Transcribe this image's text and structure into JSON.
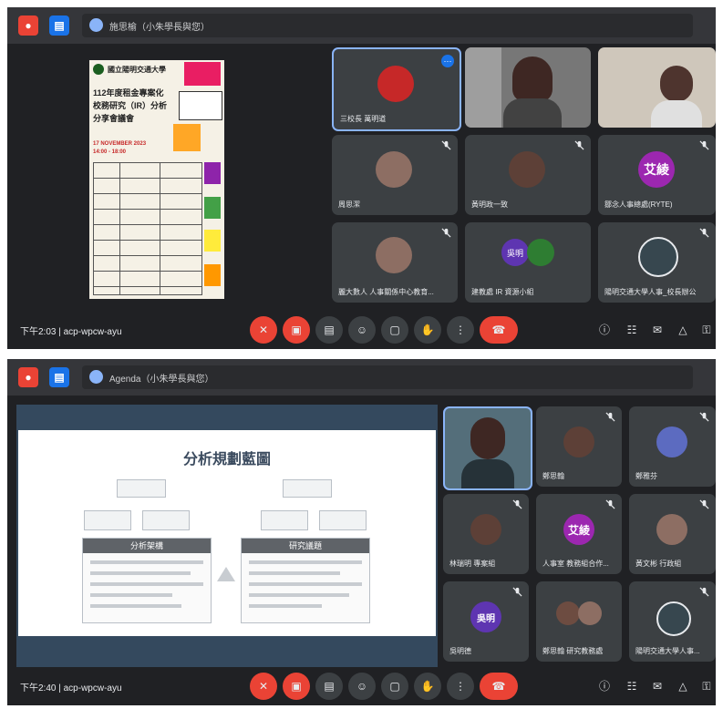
{
  "screenshots": [
    {
      "tab_title": "施思榆（小朱學長與您）",
      "clock": "下午2:03",
      "meeting_code": "acp-wpcw-ayu",
      "poster": {
        "org": "國立陽明交通大學",
        "title_lines": [
          "112年度租金專案化",
          "校務研究（IR）分析",
          "分享會議會"
        ],
        "date": "17 NOVEMBER 2023",
        "time": "14:00 - 18:00"
      },
      "participants": [
        {
          "name": "三校長 萬明道",
          "avatar": "",
          "color": "#c62828"
        },
        {
          "name": "",
          "avatar": "",
          "color": "#5d4037"
        },
        {
          "name": "",
          "avatar": "",
          "color": "#6d4c41"
        },
        {
          "name": "周思潔",
          "avatar": "",
          "color": "#8d6e63"
        },
        {
          "name": "黃明政一致",
          "avatar": "",
          "color": "#5d4037"
        },
        {
          "name": "鄒念人事總處(RYTE)",
          "avatar": "艾綾",
          "color": "#9c27b0"
        },
        {
          "name": "麗大數人 人事關係中心教育...",
          "avatar": "",
          "color": "#8d6e63"
        },
        {
          "name": "建教處 IR 資源小組",
          "avatar": "吳明",
          "color": "#5e35b1"
        },
        {
          "name": "陽明交通大學人事_校長辦公",
          "avatar": "",
          "color": "#37474f"
        }
      ]
    },
    {
      "tab_title": "Agenda（小朱學長與您）",
      "clock": "下午2:40",
      "meeting_code": "acp-wpcw-ayu",
      "slide": {
        "title": "分析規劃藍圖",
        "panel_left": "分析架構",
        "panel_right": "研究議題"
      },
      "participants": [
        {
          "name": "",
          "avatar": "",
          "color": "#6d4c41"
        },
        {
          "name": "鄭思翰",
          "avatar": "",
          "color": "#5d4037"
        },
        {
          "name": "鄭雅芬",
          "avatar": "",
          "color": "#5c6bc0"
        },
        {
          "name": "林瑞明 專案組",
          "avatar": "",
          "color": "#5d4037"
        },
        {
          "name": "人事室 教務組合作...",
          "avatar": "艾綾",
          "color": "#9c27b0"
        },
        {
          "name": "黃文彬 行政組",
          "avatar": "",
          "color": "#8d6e63"
        },
        {
          "name": "吳明德",
          "avatar": "吳明",
          "color": "#5e35b1"
        },
        {
          "name": "鄭思翰 研究教務處",
          "avatar": "",
          "color": "#6d4c41"
        },
        {
          "name": "陽明交通大學人事...",
          "avatar": "",
          "color": "#37474f"
        }
      ]
    }
  ],
  "colors": {
    "background": "#202124",
    "tile": "#3c4043",
    "end_call": "#ea4335",
    "accent": "#8ab4f8"
  },
  "icons": [
    "mic-off-icon",
    "camera-off-icon",
    "captions-icon",
    "emoji-icon",
    "present-icon",
    "raise-hand-icon",
    "more-options-icon",
    "end-call-icon",
    "info-icon",
    "people-icon",
    "chat-icon",
    "activities-icon",
    "lock-icon"
  ]
}
